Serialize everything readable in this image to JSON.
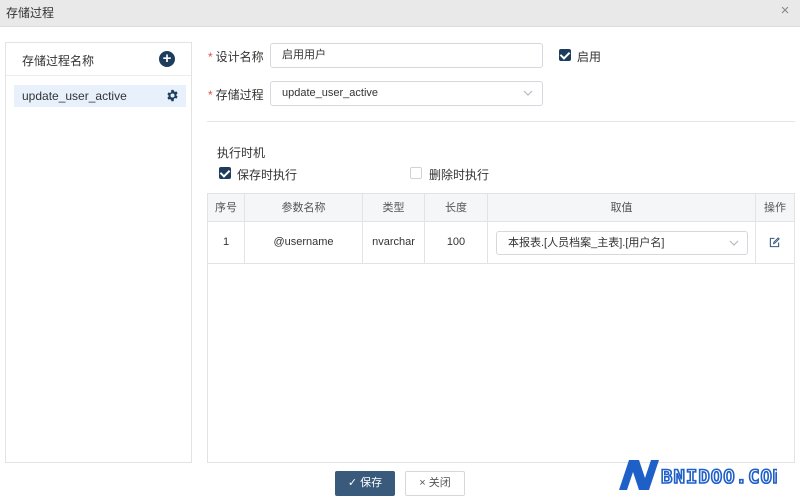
{
  "window": {
    "title": "存储过程",
    "close_glyph": "×"
  },
  "sidebar": {
    "header_label": "存储过程名称",
    "add_glyph": "+",
    "items": [
      {
        "label": "update_user_active"
      }
    ]
  },
  "form": {
    "required_mark": "*",
    "design_name": {
      "label": "设计名称",
      "value": "启用用户"
    },
    "enabled": {
      "label": "启用",
      "checked": true
    },
    "procedure": {
      "label": "存储过程",
      "value": "update_user_active"
    }
  },
  "timing": {
    "title": "执行时机",
    "on_save": {
      "label": "保存时执行",
      "checked": true
    },
    "on_delete": {
      "label": "删除时执行",
      "checked": false
    }
  },
  "params_table": {
    "headers": [
      "序号",
      "参数名称",
      "类型",
      "长度",
      "取值",
      "操作"
    ],
    "rows": [
      {
        "index": "1",
        "name": "@username",
        "type": "nvarchar",
        "length": "100",
        "value": "本报表.[人员档案_主表].[用户名]"
      }
    ]
  },
  "footer": {
    "save_label": "保存",
    "close_label": "关闭"
  },
  "colors": {
    "accent": "#1e3c5c",
    "save_button": "#3a5a7c",
    "required": "#e54d42",
    "selected_row": "#e8f1fb"
  },
  "watermark": {
    "text": "NBNIDOO.COM"
  },
  "icons": [
    "close-icon",
    "add-icon",
    "gear-icon",
    "checkbox-icon",
    "chevron-down-icon",
    "edit-icon",
    "check-icon",
    "x-icon"
  ]
}
